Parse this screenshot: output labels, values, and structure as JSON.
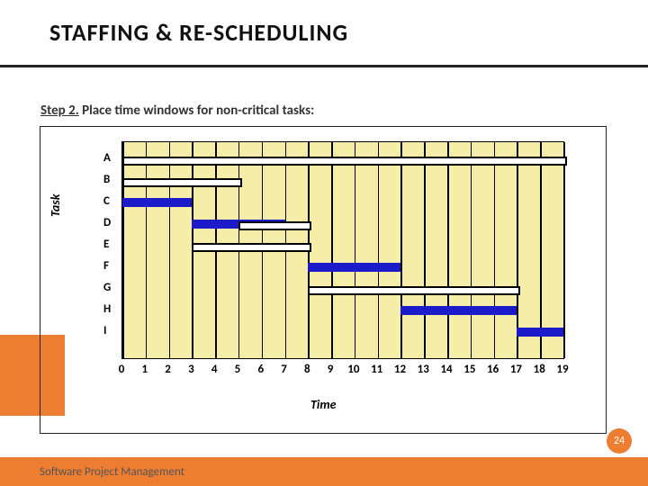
{
  "title": "STAFFING & RE-SCHEDULING",
  "step_label": "Step 2.",
  "step_text": " Place time windows for non-critical tasks:",
  "footer": "Software Project Management",
  "page_num": "24",
  "chart_data": {
    "type": "bar",
    "xlabel": "Time",
    "ylabel": "Task",
    "xlim": [
      0,
      19
    ],
    "xticks": [
      0,
      1,
      2,
      3,
      4,
      5,
      6,
      7,
      8,
      9,
      10,
      11,
      12,
      13,
      14,
      15,
      16,
      17,
      18,
      19
    ],
    "categories": [
      "A",
      "B",
      "C",
      "D",
      "E",
      "F",
      "G",
      "H",
      "I"
    ],
    "bars": [
      {
        "task": "A",
        "type": "window",
        "start": 0,
        "end": 19
      },
      {
        "task": "B",
        "type": "window",
        "start": 0,
        "end": 5
      },
      {
        "task": "C",
        "type": "bar",
        "start": 0,
        "end": 3
      },
      {
        "task": "D",
        "type": "bar",
        "start": 3,
        "end": 7
      },
      {
        "task": "D",
        "type": "window",
        "start": 5,
        "end": 8
      },
      {
        "task": "E",
        "type": "window",
        "start": 3,
        "end": 8
      },
      {
        "task": "F",
        "type": "bar",
        "start": 8,
        "end": 12
      },
      {
        "task": "G",
        "type": "window",
        "start": 8,
        "end": 17
      },
      {
        "task": "H",
        "type": "bar",
        "start": 12,
        "end": 17
      },
      {
        "task": "I",
        "type": "bar",
        "start": 17,
        "end": 19
      }
    ]
  }
}
